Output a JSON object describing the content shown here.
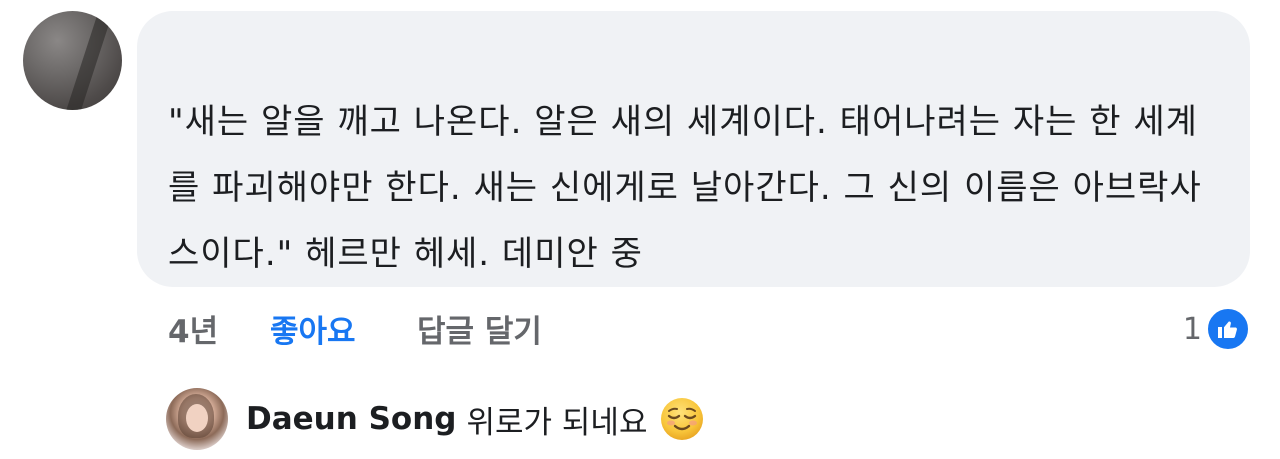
{
  "comment": {
    "text": "\"새는 알을 깨고 나온다. 알은 새의 세계이다. 태어나려는 자는 한 세계를 파괴해야만 한다. 새는 신에게로 날아간다. 그 신의 이름은 아브락사스이다.\" 헤르만 헤세. 데미안 중",
    "time": "4년",
    "like_label": "좋아요",
    "reply_label": "답글 달기",
    "reaction_count": "1",
    "reaction_icon": "thumbs-up-icon",
    "accent_color": "#1877f2"
  },
  "reply": {
    "author": "Daeun Song",
    "text": "위로가 되네요",
    "emoji": "relieved-face-emoji"
  }
}
